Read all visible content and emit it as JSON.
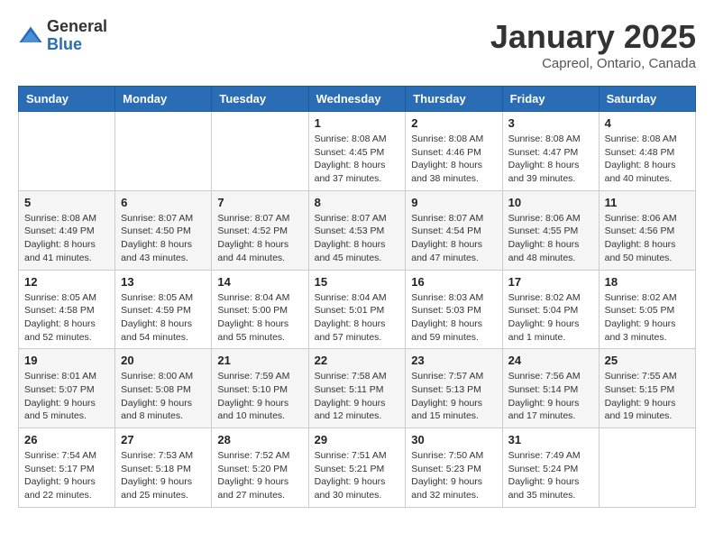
{
  "header": {
    "logo_general": "General",
    "logo_blue": "Blue",
    "month": "January 2025",
    "location": "Capreol, Ontario, Canada"
  },
  "weekdays": [
    "Sunday",
    "Monday",
    "Tuesday",
    "Wednesday",
    "Thursday",
    "Friday",
    "Saturday"
  ],
  "weeks": [
    [
      {
        "day": "",
        "info": ""
      },
      {
        "day": "",
        "info": ""
      },
      {
        "day": "",
        "info": ""
      },
      {
        "day": "1",
        "info": "Sunrise: 8:08 AM\nSunset: 4:45 PM\nDaylight: 8 hours and 37 minutes."
      },
      {
        "day": "2",
        "info": "Sunrise: 8:08 AM\nSunset: 4:46 PM\nDaylight: 8 hours and 38 minutes."
      },
      {
        "day": "3",
        "info": "Sunrise: 8:08 AM\nSunset: 4:47 PM\nDaylight: 8 hours and 39 minutes."
      },
      {
        "day": "4",
        "info": "Sunrise: 8:08 AM\nSunset: 4:48 PM\nDaylight: 8 hours and 40 minutes."
      }
    ],
    [
      {
        "day": "5",
        "info": "Sunrise: 8:08 AM\nSunset: 4:49 PM\nDaylight: 8 hours and 41 minutes."
      },
      {
        "day": "6",
        "info": "Sunrise: 8:07 AM\nSunset: 4:50 PM\nDaylight: 8 hours and 43 minutes."
      },
      {
        "day": "7",
        "info": "Sunrise: 8:07 AM\nSunset: 4:52 PM\nDaylight: 8 hours and 44 minutes."
      },
      {
        "day": "8",
        "info": "Sunrise: 8:07 AM\nSunset: 4:53 PM\nDaylight: 8 hours and 45 minutes."
      },
      {
        "day": "9",
        "info": "Sunrise: 8:07 AM\nSunset: 4:54 PM\nDaylight: 8 hours and 47 minutes."
      },
      {
        "day": "10",
        "info": "Sunrise: 8:06 AM\nSunset: 4:55 PM\nDaylight: 8 hours and 48 minutes."
      },
      {
        "day": "11",
        "info": "Sunrise: 8:06 AM\nSunset: 4:56 PM\nDaylight: 8 hours and 50 minutes."
      }
    ],
    [
      {
        "day": "12",
        "info": "Sunrise: 8:05 AM\nSunset: 4:58 PM\nDaylight: 8 hours and 52 minutes."
      },
      {
        "day": "13",
        "info": "Sunrise: 8:05 AM\nSunset: 4:59 PM\nDaylight: 8 hours and 54 minutes."
      },
      {
        "day": "14",
        "info": "Sunrise: 8:04 AM\nSunset: 5:00 PM\nDaylight: 8 hours and 55 minutes."
      },
      {
        "day": "15",
        "info": "Sunrise: 8:04 AM\nSunset: 5:01 PM\nDaylight: 8 hours and 57 minutes."
      },
      {
        "day": "16",
        "info": "Sunrise: 8:03 AM\nSunset: 5:03 PM\nDaylight: 8 hours and 59 minutes."
      },
      {
        "day": "17",
        "info": "Sunrise: 8:02 AM\nSunset: 5:04 PM\nDaylight: 9 hours and 1 minute."
      },
      {
        "day": "18",
        "info": "Sunrise: 8:02 AM\nSunset: 5:05 PM\nDaylight: 9 hours and 3 minutes."
      }
    ],
    [
      {
        "day": "19",
        "info": "Sunrise: 8:01 AM\nSunset: 5:07 PM\nDaylight: 9 hours and 5 minutes."
      },
      {
        "day": "20",
        "info": "Sunrise: 8:00 AM\nSunset: 5:08 PM\nDaylight: 9 hours and 8 minutes."
      },
      {
        "day": "21",
        "info": "Sunrise: 7:59 AM\nSunset: 5:10 PM\nDaylight: 9 hours and 10 minutes."
      },
      {
        "day": "22",
        "info": "Sunrise: 7:58 AM\nSunset: 5:11 PM\nDaylight: 9 hours and 12 minutes."
      },
      {
        "day": "23",
        "info": "Sunrise: 7:57 AM\nSunset: 5:13 PM\nDaylight: 9 hours and 15 minutes."
      },
      {
        "day": "24",
        "info": "Sunrise: 7:56 AM\nSunset: 5:14 PM\nDaylight: 9 hours and 17 minutes."
      },
      {
        "day": "25",
        "info": "Sunrise: 7:55 AM\nSunset: 5:15 PM\nDaylight: 9 hours and 19 minutes."
      }
    ],
    [
      {
        "day": "26",
        "info": "Sunrise: 7:54 AM\nSunset: 5:17 PM\nDaylight: 9 hours and 22 minutes."
      },
      {
        "day": "27",
        "info": "Sunrise: 7:53 AM\nSunset: 5:18 PM\nDaylight: 9 hours and 25 minutes."
      },
      {
        "day": "28",
        "info": "Sunrise: 7:52 AM\nSunset: 5:20 PM\nDaylight: 9 hours and 27 minutes."
      },
      {
        "day": "29",
        "info": "Sunrise: 7:51 AM\nSunset: 5:21 PM\nDaylight: 9 hours and 30 minutes."
      },
      {
        "day": "30",
        "info": "Sunrise: 7:50 AM\nSunset: 5:23 PM\nDaylight: 9 hours and 32 minutes."
      },
      {
        "day": "31",
        "info": "Sunrise: 7:49 AM\nSunset: 5:24 PM\nDaylight: 9 hours and 35 minutes."
      },
      {
        "day": "",
        "info": ""
      }
    ]
  ]
}
